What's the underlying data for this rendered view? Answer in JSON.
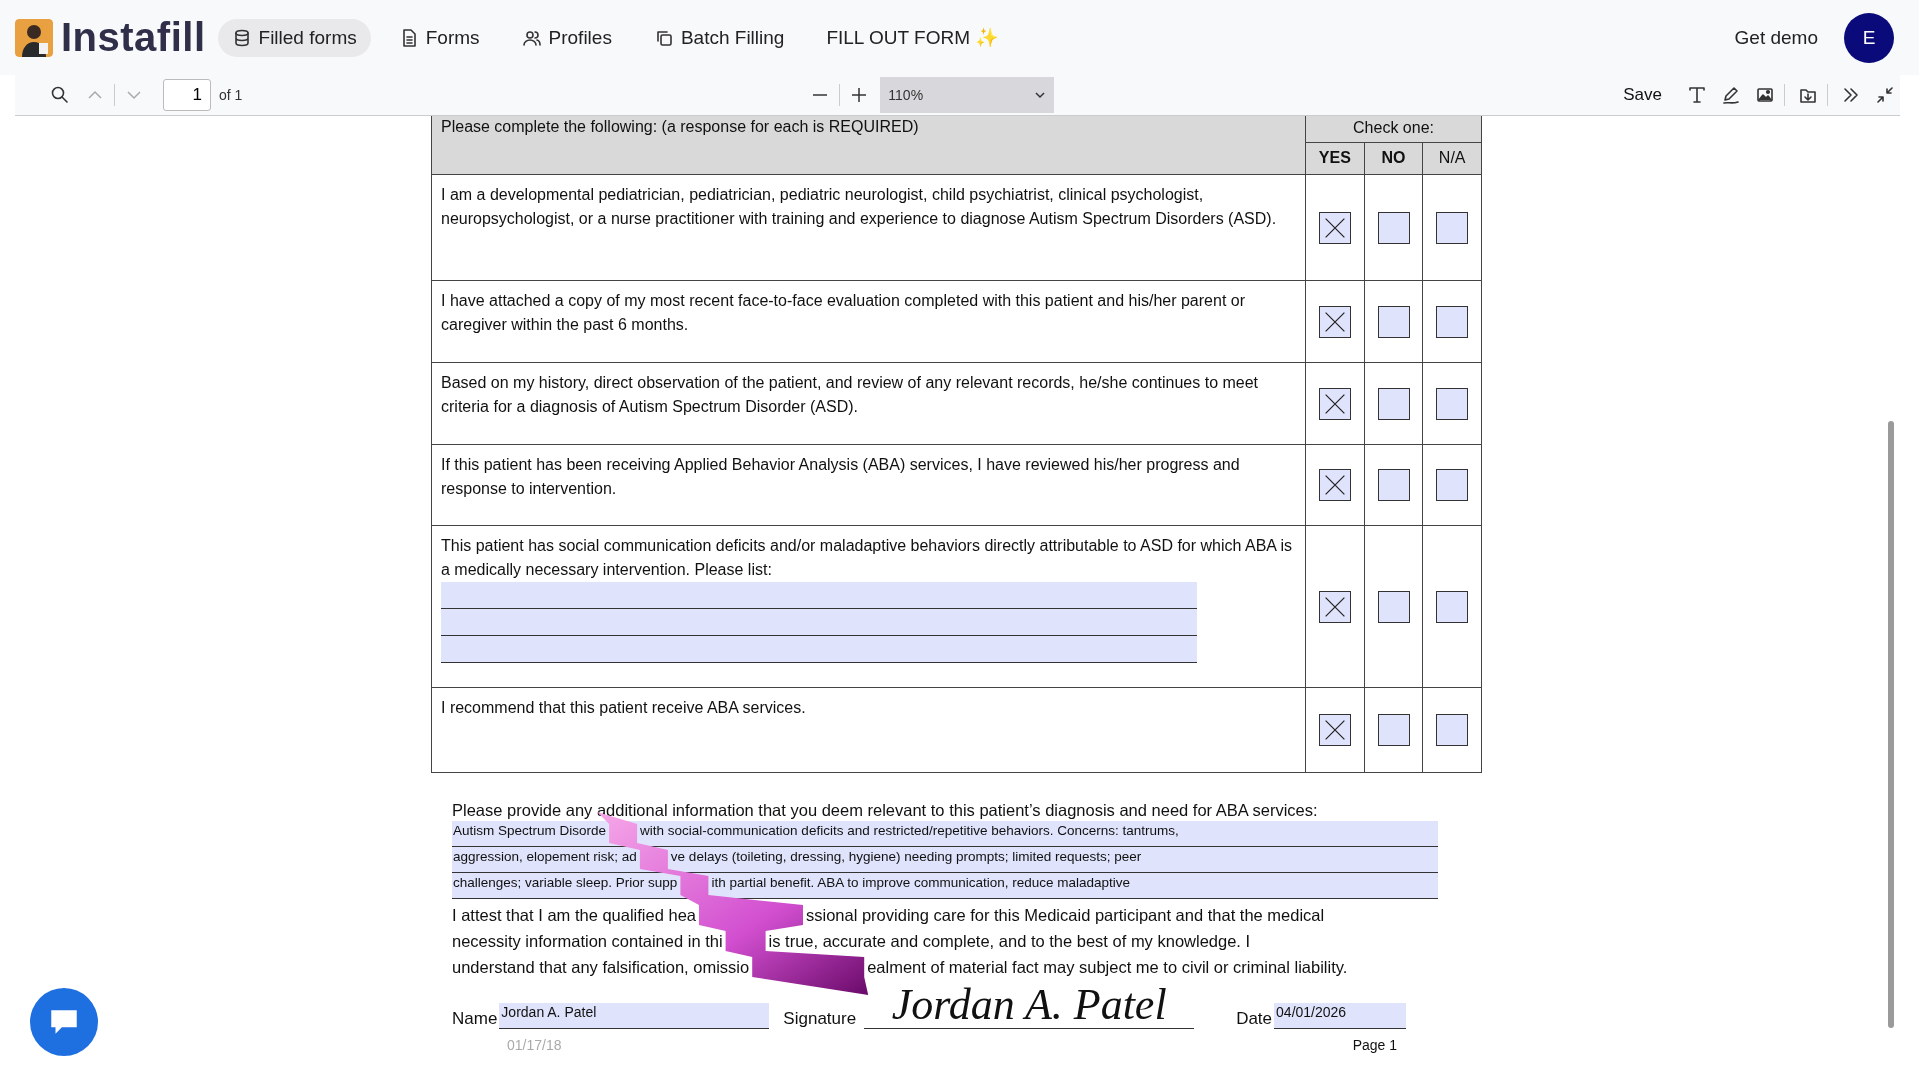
{
  "nav": {
    "brand": "Instafill",
    "items": [
      {
        "label": "Filled forms",
        "selected": true
      },
      {
        "label": "Forms",
        "selected": false
      },
      {
        "label": "Profiles",
        "selected": false
      },
      {
        "label": "Batch Filling",
        "selected": false
      },
      {
        "label": "FILL OUT FORM ✨",
        "selected": false
      }
    ],
    "demo": "Get demo",
    "avatar": "E"
  },
  "toolbar": {
    "page": "1",
    "page_count": "of 1",
    "zoom": "110%",
    "save": "Save"
  },
  "form": {
    "header": "Please complete the following: (a response for each is REQUIRED)",
    "check_header": "Check one:",
    "columns": [
      "YES",
      "NO",
      "N/A"
    ],
    "rows": [
      {
        "kind": "plain",
        "text": "I am a developmental pediatrician, pediatrician, pediatric neurologist, child psychiatrist, clinical psychologist, neuropsychologist, or a nurse practitioner with training and experience to diagnose Autism Spectrum Disorders (ASD).",
        "checks": [
          {
            "checked": true
          },
          {
            "checked": false
          },
          {
            "checked": false
          }
        ]
      },
      {
        "kind": "plain",
        "text": "I have attached a copy of my most recent face-to-face evaluation completed with this patient and his/her parent or caregiver within the past 6 months.",
        "checks": [
          {
            "checked": true
          },
          {
            "checked": false
          },
          {
            "checked": false
          }
        ]
      },
      {
        "kind": "plain",
        "text": "Based on my history, direct observation of the patient, and review of any relevant records, he/she continues to meet criteria for a diagnosis of Autism Spectrum Disorder (ASD).",
        "checks": [
          {
            "checked": true
          },
          {
            "checked": false
          },
          {
            "checked": false
          }
        ]
      },
      {
        "kind": "plain",
        "text": "If this patient has been receiving Applied Behavior Analysis (ABA) services, I have reviewed his/her progress and response to intervention.",
        "checks": [
          {
            "checked": true
          },
          {
            "checked": false
          },
          {
            "checked": false
          }
        ]
      },
      {
        "kind": "list",
        "text": "This patient has social communication deficits and/or maladaptive behaviors directly attributable to ASD for which ABA is a medically necessary intervention.  Please list:",
        "checks": [
          {
            "checked": true
          },
          {
            "checked": false
          },
          {
            "checked": false
          }
        ]
      },
      {
        "kind": "plain",
        "text": "I recommend that this patient receive ABA services.",
        "checks": [
          {
            "checked": true
          },
          {
            "checked": false
          },
          {
            "checked": false
          }
        ]
      }
    ],
    "additional_prompt": "Please provide any additional information that you deem relevant to this patient’s diagnosis and need for ABA services:",
    "additional_lines": [
      [
        "Autism Spectrum Disorde",
        "with social-communication deficits and restricted/repetitive behaviors. Concerns: tantrums,"
      ],
      [
        "aggression, elopement risk; ad",
        "ve delays (toileting, dressing, hygiene) needing prompts; limited requests; peer"
      ],
      [
        "challenges; variable sleep. Prior supp",
        "ith partial benefit. ABA to improve communication, reduce maladaptive"
      ]
    ],
    "attestation_lines": [
      [
        "I attest that I am the qualified hea",
        "ssional providing care for this Medicaid participant and that the medical"
      ],
      [
        "necessity information contained in thi",
        "is true, accurate and complete, and to the best of my knowledge. I"
      ],
      [
        "understand that any falsification, omissio",
        "ealment of material fact may subject me to civil or criminal liability."
      ]
    ],
    "name_label": "Name",
    "name": "Jordan A. Patel",
    "signature_label": "Signature",
    "signature": "Jordan A. Patel",
    "date_label": "Date",
    "date": "04/01/2026",
    "footer_date": "01/17/18",
    "footer_page": "Page 1"
  }
}
